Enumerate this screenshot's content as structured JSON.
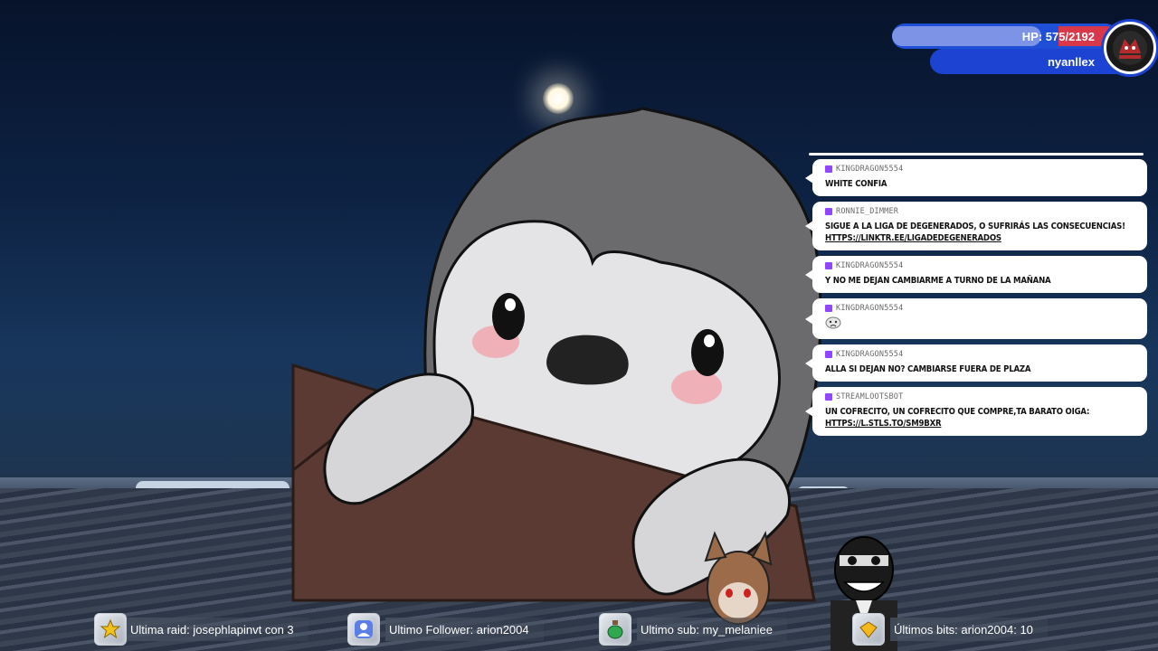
{
  "hp_widget": {
    "hp_label": "HP: 575/2192",
    "hp_fraction": 0.262,
    "username": "nyanllex",
    "colors": {
      "bar": "#1f4fd6",
      "fill": "#7d94e6",
      "damage": "#d8384a"
    }
  },
  "chat": {
    "messages": [
      {
        "user": "kingdragon5554",
        "text": "white confia",
        "link": ""
      },
      {
        "user": "ronnie_dimmer",
        "text": "sigue a la liga de degenerados, o sufrirás las consecuencias!",
        "link": "https://linktr.ee/ligadedegenerados"
      },
      {
        "user": "kingdragon5554",
        "text": "y no me dejan cambiarme a turno de la mañana",
        "link": ""
      },
      {
        "user": "kingdragon5554",
        "text": "",
        "link": "",
        "emote": "sad-face-emote"
      },
      {
        "user": "kingdragon5554",
        "text": "alla si dejan no? cambiarse fuera de plaza",
        "link": ""
      },
      {
        "user": "streamlootsbot",
        "text": "un cofrecito, un cofrecito que compre,ta barato oiga:",
        "link": "https://l.stls.to/sm9bxr"
      }
    ]
  },
  "bottom_bar": {
    "raid": {
      "label": "Ultima raid: josephlapinvt con 3",
      "icon": "star-icon"
    },
    "follower": {
      "label": "Ultimo Follower: arion2004",
      "icon": "user-icon"
    },
    "sub": {
      "label": "Ultimo sub: my_melaniee",
      "icon": "potion-icon"
    },
    "bits": {
      "label": "Últimos bits: arion2004: 10",
      "icon": "diamond-icon"
    }
  }
}
